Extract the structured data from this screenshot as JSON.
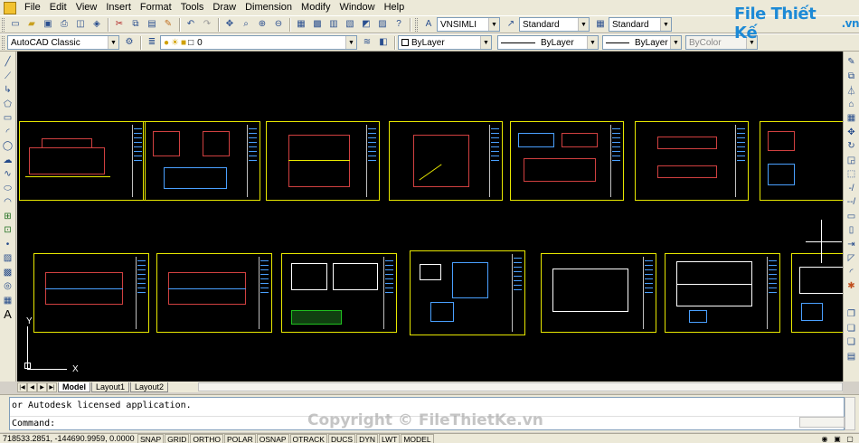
{
  "menu": [
    "File",
    "Edit",
    "View",
    "Insert",
    "Format",
    "Tools",
    "Draw",
    "Dimension",
    "Modify",
    "Window",
    "Help"
  ],
  "toolbar1": {
    "text_style": "VNSIMLI",
    "dim_style": "Standard",
    "table_style": "Standard"
  },
  "toolbar2": {
    "workspace": "AutoCAD Classic",
    "layer": "0",
    "color": "ByLayer",
    "linetype": "ByLayer",
    "lineweight": "ByLayer",
    "plot_style": "ByColor"
  },
  "logo": {
    "name": "File Thiết Kế",
    "domain": ".vn"
  },
  "canvas": {
    "ucs_y": "Y",
    "ucs_x": "X"
  },
  "tabs": [
    "Model",
    "Layout1",
    "Layout2"
  ],
  "command": {
    "history": "or Autodesk licensed application.",
    "prompt": "Command:"
  },
  "watermark": "Copyright © FileThietKe.vn",
  "status": {
    "coords": "718533.2851, -144690.9959, 0.0000",
    "toggles": [
      "SNAP",
      "GRID",
      "ORTHO",
      "POLAR",
      "OSNAP",
      "OTRACK",
      "DUCS",
      "DYN",
      "LWT",
      "MODEL"
    ]
  },
  "colors": {
    "canvas_bg": "#000000",
    "sheet_border": "#e8e800",
    "ui_bg": "#ece9d8",
    "logo": "#1d8ad6"
  }
}
